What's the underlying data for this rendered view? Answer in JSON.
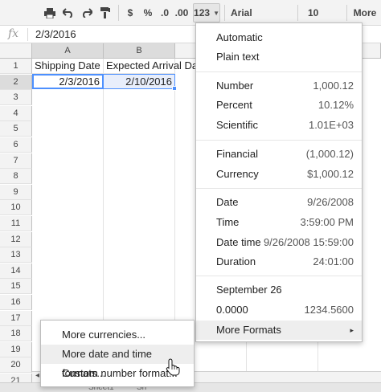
{
  "toolbar": {
    "print_icon": "print-icon",
    "undo_icon": "undo-icon",
    "redo_icon": "redo-icon",
    "paint_format_icon": "paint-format-icon",
    "currency_label": "$",
    "percent_label": "%",
    "decrease_decimals_label": ".0",
    "increase_decimals_label": ".00",
    "more_formats_label": "123",
    "font_label": "Arial",
    "font_size_label": "10",
    "more_label": "More"
  },
  "formula_bar": {
    "fx_label": "fx",
    "value": "2/3/2016"
  },
  "sheet": {
    "columns": [
      "A",
      "B"
    ],
    "rows": [
      "1",
      "2",
      "3",
      "4",
      "5",
      "6",
      "7",
      "8",
      "9",
      "10",
      "11",
      "12",
      "13",
      "14",
      "15",
      "16",
      "17",
      "18",
      "19",
      "20",
      "21"
    ],
    "cells": {
      "a1": "Shipping Date",
      "b1": "Expected Arrival Date",
      "a2": "2/3/2016",
      "b2": "2/10/2016"
    },
    "scroll_left": "◂",
    "tab_fragments": [
      "Sheet1",
      "Sh"
    ]
  },
  "format_menu": {
    "automatic": "Automatic",
    "plain_text": "Plain text",
    "number": {
      "label": "Number",
      "example": "1,000.12"
    },
    "percent": {
      "label": "Percent",
      "example": "10.12%"
    },
    "scientific": {
      "label": "Scientific",
      "example": "1.01E+03"
    },
    "financial": {
      "label": "Financial",
      "example": "(1,000.12)"
    },
    "currency": {
      "label": "Currency",
      "example": "$1,000.12"
    },
    "date": {
      "label": "Date",
      "example": "9/26/2008"
    },
    "time": {
      "label": "Time",
      "example": "3:59:00 PM"
    },
    "date_time": {
      "label": "Date time",
      "example": "9/26/2008 15:59:00"
    },
    "duration": {
      "label": "Duration",
      "example": "24:01:00"
    },
    "custom_date": {
      "label": "September 26"
    },
    "custom_number": {
      "label": "0.0000",
      "example": "1234.5600"
    },
    "more_formats": {
      "label": "More Formats",
      "arrow": "▸"
    }
  },
  "more_formats_submenu": {
    "more_currencies": "More currencies...",
    "more_date_time": "More date and time formats...",
    "custom_number": "Custom number format..."
  },
  "colors": {
    "selection_blue": "#4d90fe",
    "range_fill": "#e8eefb",
    "header_bg": "#f3f3f3",
    "hover_bg": "#eeeeee"
  }
}
